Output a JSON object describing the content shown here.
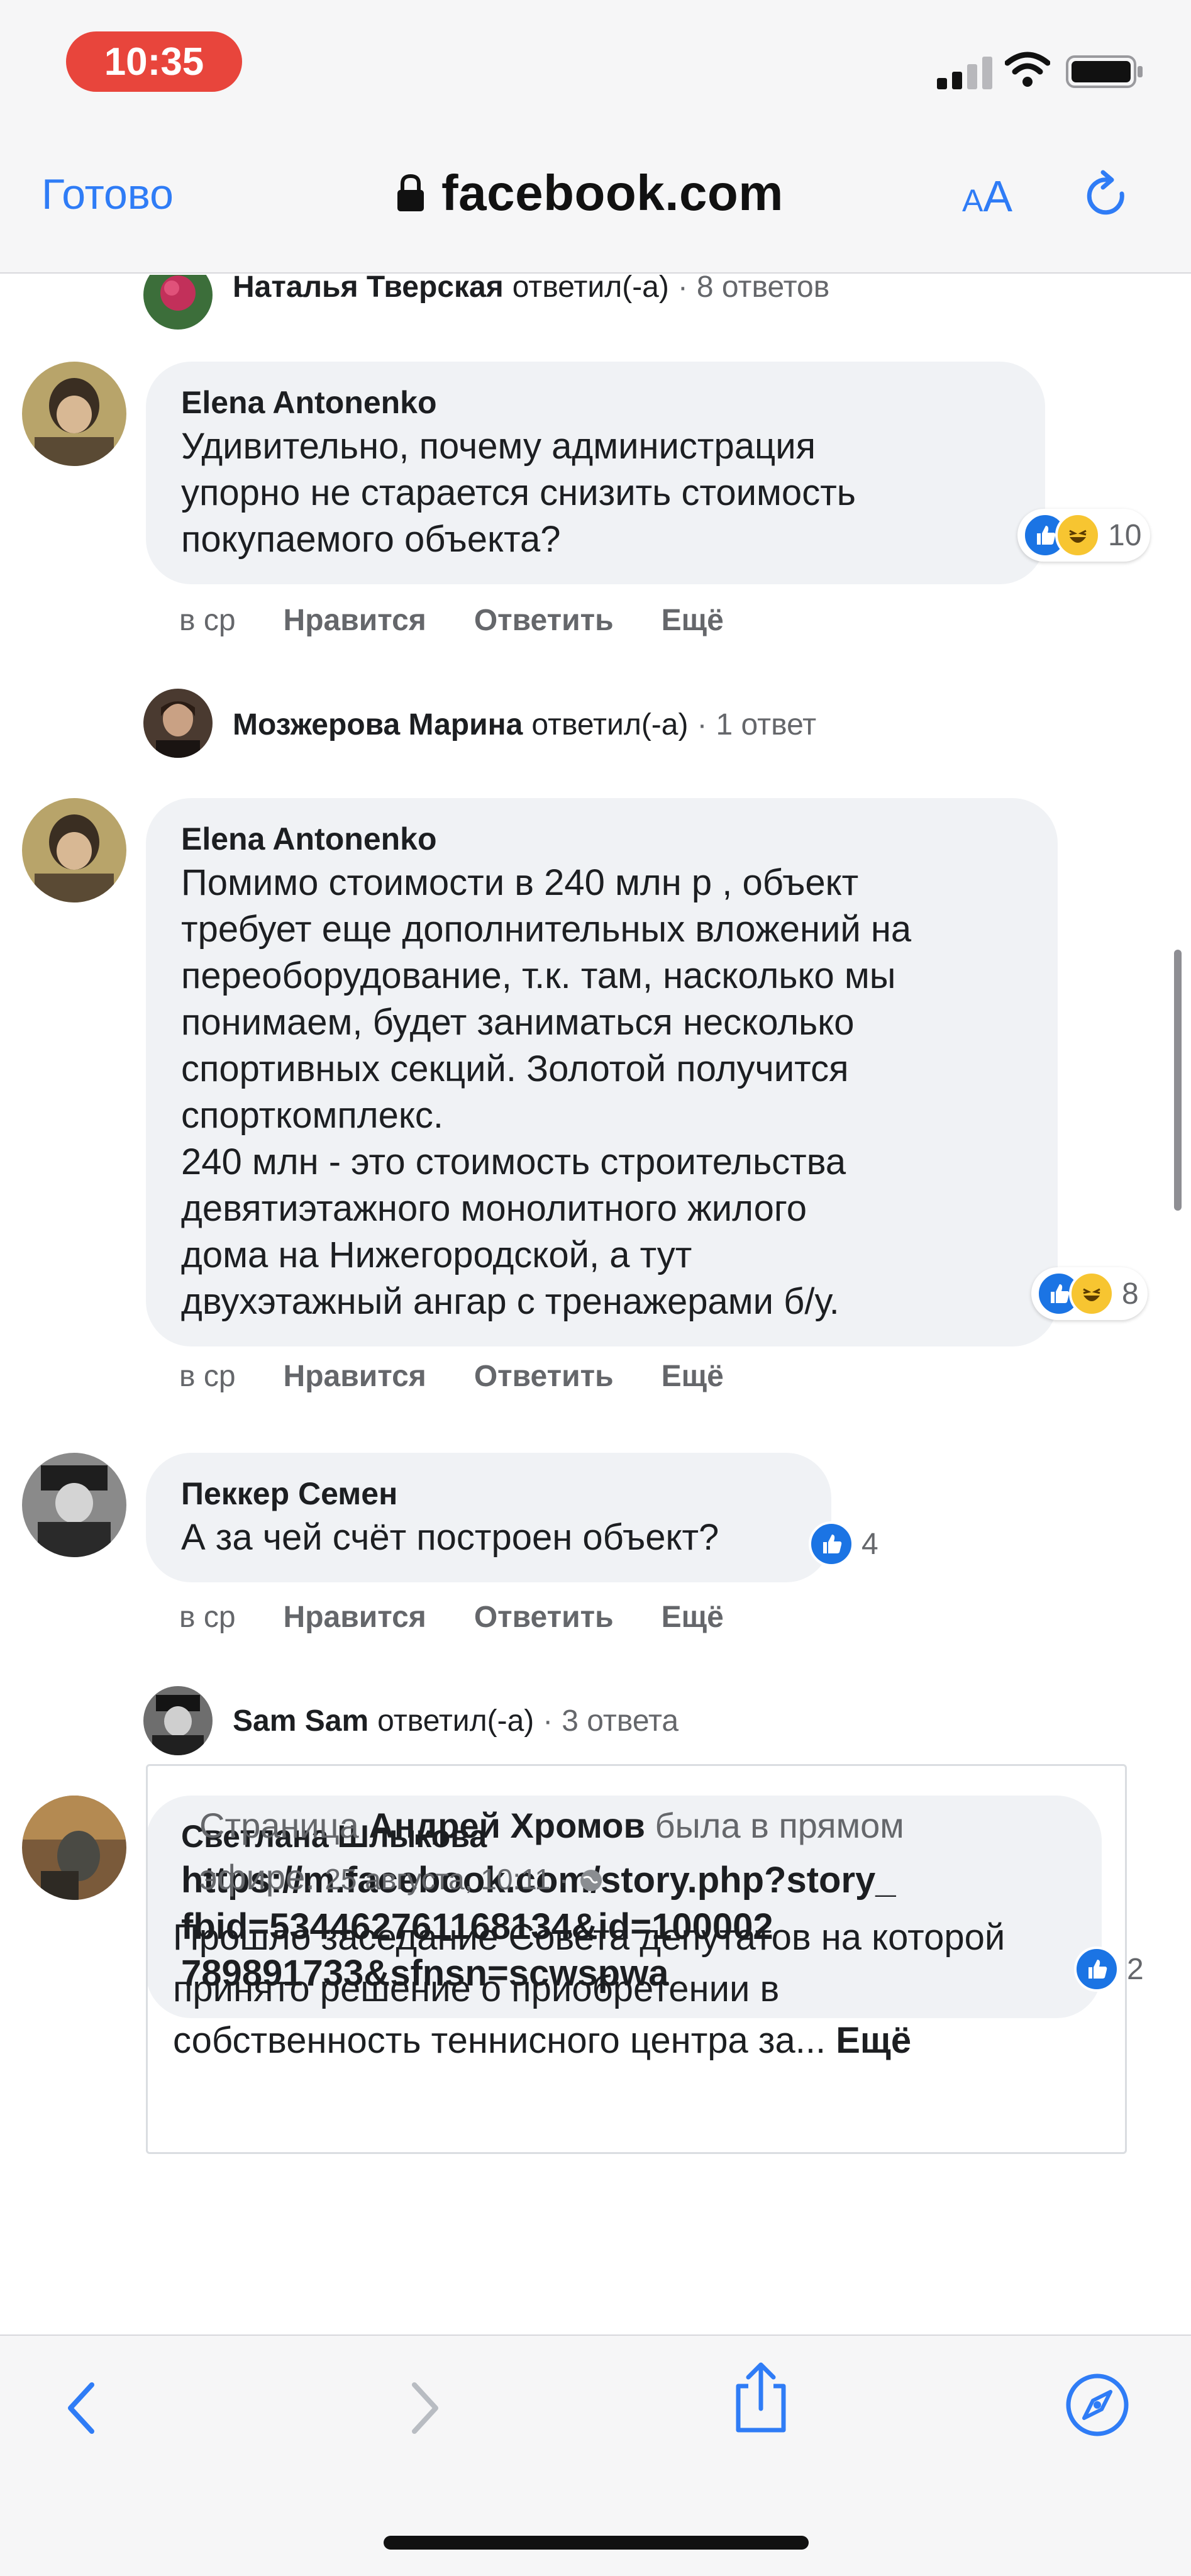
{
  "status_bar": {
    "time": "10:35"
  },
  "browser": {
    "done_label": "Готово",
    "url": "facebook.com",
    "text_size_small": "A",
    "text_size_big": "A"
  },
  "comments": [
    {
      "kind": "reply_summary",
      "name": "Наталья Тверская",
      "verb": "ответил(-а)",
      "count": "8 ответов"
    },
    {
      "kind": "comment",
      "author": "Elena Antonenko",
      "lines": [
        "Удивительно, почему администрация",
        "упорно не старается снизить стоимость",
        "покупаемого объекта?"
      ],
      "reaction_count": "10",
      "time": "в ср",
      "like": "Нравится",
      "reply": "Ответить",
      "more": "Ещё"
    },
    {
      "kind": "reply_summary",
      "name": "Мозжерова Марина",
      "verb": "ответил(-а)",
      "count": "1 ответ"
    },
    {
      "kind": "comment",
      "author": "Elena Antonenko",
      "lines": [
        "Помимо стоимости в 240 млн р , объект",
        "требует еще дополнительных вложений на",
        "переоборудование, т.к. там, насколько мы",
        "понимаем, будет заниматься несколько",
        "спортивных секций. Золотой получится",
        "спорткомплекс.",
        "240 млн - это стоимость строительства",
        "девятиэтажного монолитного жилого",
        "дома на Нижегородской, а тут",
        "двухэтажный ангар с тренажерами б/у."
      ],
      "reaction_count": "8",
      "time": "в ср",
      "like": "Нравится",
      "reply": "Ответить",
      "more": "Ещё"
    },
    {
      "kind": "comment",
      "author": "Пеккер Семен",
      "lines": [
        "А за чей счёт построен объект?"
      ],
      "reaction_count": "4",
      "time": "в ср",
      "like": "Нравится",
      "reply": "Ответить",
      "more": "Ещё"
    },
    {
      "kind": "reply_summary",
      "name": "Sam Sam",
      "verb": "ответил(-а)",
      "count": "3 ответа"
    },
    {
      "kind": "comment",
      "author": "Светлана Шлыкова",
      "lines": [
        "https://m.facebook.com/story.php?story_",
        "fbid=534462761168134&id=100002",
        "789891733&sfnsn=scwspwa"
      ],
      "reaction_count": "2"
    }
  ],
  "shared_post": {
    "prefix": "Страница",
    "page_name": "Андрей Хромов",
    "suffix_1": "была в прямом",
    "suffix_2": "эфире.",
    "date": "25 августа, 10:11 ·",
    "text_lines": [
      "Прошло заседание Совета депутатов на которой",
      "принято решение о приобретении в",
      "собственность теннисного центра за..."
    ],
    "more": "Ещё"
  },
  "colors": {
    "accent": "#2f7cf6",
    "time_pill": "#e8453c",
    "bubble": "#f0f2f5",
    "like": "#1b74e4",
    "haha": "#f7c531",
    "muted": "#65676b"
  },
  "icons": {
    "toolbar": [
      "back-icon",
      "forward-icon",
      "share-icon",
      "compass-icon"
    ],
    "header": [
      "lock-icon",
      "reload-icon"
    ]
  }
}
